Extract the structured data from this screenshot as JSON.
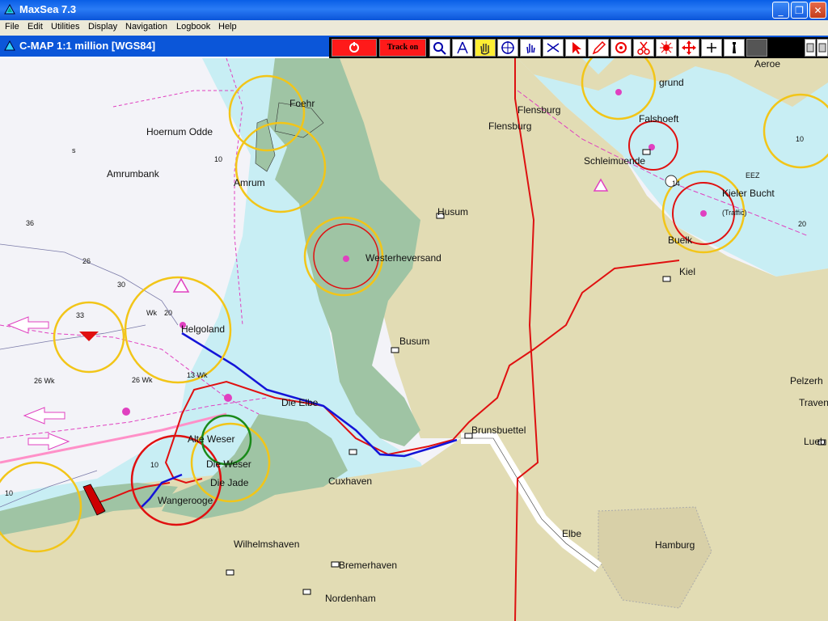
{
  "window": {
    "title": "MaxSea 7.3",
    "minimize": "_",
    "restore": "❐",
    "close": "✕"
  },
  "menu": [
    "File",
    "Edit",
    "Utilities",
    "Display",
    "Navigation",
    "Logbook",
    "Help"
  ],
  "chart": {
    "title": "C-MAP  1:1 million [WGS84]"
  },
  "toolbar": {
    "track_label": "Track on"
  },
  "labels": {
    "hoernum_odde": "Hoernum Odde",
    "amrumbank": "Amrumbank",
    "foehr": "Foehr",
    "amrum": "Amrum",
    "husum": "Husum",
    "westerheversand": "Westerheversand",
    "busum": "Busum",
    "helgoland": "Helgoland",
    "die_elbe": "Die Elbe",
    "brunsbuettel": "Brunsbuettel",
    "alte_weser": "Alte Weser",
    "die_weser": "Die Weser",
    "die_jade": "Die Jade",
    "cuxhaven": "Cuxhaven",
    "wangerooge": "Wangerooge",
    "wilhelmshaven": "Wilhelmshaven",
    "bremerhaven": "Bremerhaven",
    "nordenham": "Nordenham",
    "elbe": "Elbe",
    "hamburg": "Hamburg",
    "flensburg1": "Flensburg",
    "flensburg2": "Flensburg",
    "schleimuende": "Schleimuende",
    "falshoeft": "Falshoeft",
    "kieler_bucht": "Kieler Bucht",
    "traffic": "(Traffic)",
    "buelk": "Buelk",
    "kiel": "Kiel",
    "aeroe": "Aeroe",
    "pelzerh": "Pelzerh",
    "traven": "Traven",
    "luebeck": "Lueb",
    "gelting": "grund",
    "eez": "EEZ",
    "s": "s",
    "d36": "36",
    "d26": "26",
    "d30": "30",
    "d33": "33",
    "d20": "20",
    "d10a": "10",
    "d10b": "10",
    "d10c": "10",
    "d10d": "10",
    "d14": "14",
    "d20b": "20",
    "wk1": "26 Wk",
    "wk2": "26 Wk",
    "wk3": "13 Wk",
    "wk4": "Wk"
  },
  "colors": {
    "land": "#e2dcb4",
    "tidal": "#9fc4a4",
    "shallow": "#c8eef4",
    "deep": "#f3f3f8",
    "route_blue": "#1414d8",
    "track_red": "#e01010",
    "boundary": "#dd1111",
    "range_ring": "#f2c518"
  }
}
